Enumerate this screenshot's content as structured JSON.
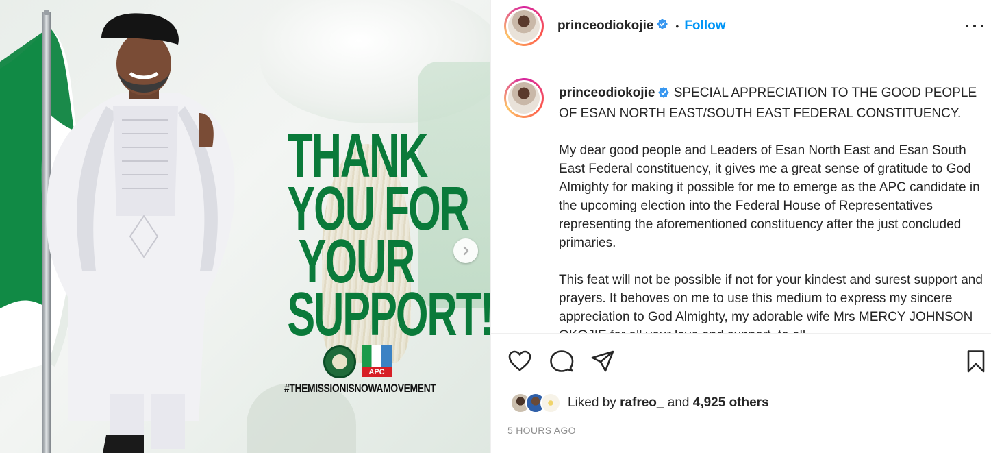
{
  "post": {
    "username": "princeodiokojie",
    "follow_label": "Follow",
    "separator": "•",
    "timestamp": "5 HOURS AGO"
  },
  "caption": {
    "username": "princeodiokojie",
    "paragraphs": [
      "SPECIAL APPRECIATION TO THE GOOD PEOPLE OF ESAN NORTH EAST/SOUTH EAST FEDERAL CONSTITUENCY.",
      "My dear good people and Leaders of Esan North East and Esan South East Federal constituency, it gives me a great sense of gratitude to God Almighty for making it possible for me to emerge as the APC candidate in the upcoming election into the Federal House of Representatives representing the aforementioned constituency after the just concluded primaries.",
      "This feat will not be possible if not for your kindest and surest support and prayers. It behoves on me to use this medium to express my sincere appreciation to God Almighty, my adorable wife Mrs MERCY JOHNSON OKOJIE for all your love and support, to all"
    ]
  },
  "image": {
    "headline": [
      "THANK",
      "YOU FOR",
      "YOUR",
      "SUPPORT!"
    ],
    "hashtag": "#THEMISSIONISNOWAMOVEMENT",
    "party_label": "APC",
    "colors": {
      "green": "#0a7a3a",
      "flag_green": "#1a8a4a"
    }
  },
  "likes": {
    "prefix": "Liked by",
    "first_user": "rafreo_",
    "connector": "and",
    "others": "4,925 others"
  },
  "icons": [
    "heart-icon",
    "comment-icon",
    "share-icon",
    "bookmark-icon",
    "more-icon",
    "verified-icon",
    "chevron-right-icon"
  ],
  "colors": {
    "link": "#0095f6",
    "text": "#262626",
    "muted": "#8e8e8e"
  }
}
